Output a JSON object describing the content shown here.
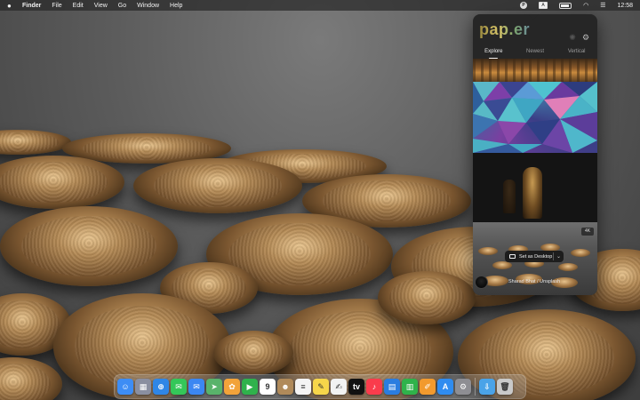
{
  "menubar": {
    "app_name": "Finder",
    "menus": [
      "File",
      "Edit",
      "View",
      "Go",
      "Window",
      "Help"
    ],
    "input_source": "A",
    "clock": "12:58"
  },
  "paper_app": {
    "logo": "pap.er",
    "tabs": [
      {
        "label": "Explore",
        "active": true
      },
      {
        "label": "Newest",
        "active": false
      },
      {
        "label": "Vertical",
        "active": false
      }
    ],
    "feed": {
      "badge": "4K",
      "set_desktop_label": "Set as Desktop",
      "credit": "Sharad Bhat / Unsplash"
    }
  },
  "dock": {
    "apps": [
      {
        "name": "finder-icon",
        "color": "#3d8df5",
        "glyph": "☺"
      },
      {
        "name": "launchpad-icon",
        "color": "#8a8fa0",
        "glyph": "▦"
      },
      {
        "name": "safari-icon",
        "color": "#2f86e6",
        "glyph": "⊕"
      },
      {
        "name": "messages-icon",
        "color": "#34c759",
        "glyph": "✉"
      },
      {
        "name": "mail-icon",
        "color": "#3b87f2",
        "glyph": "✉"
      },
      {
        "name": "maps-icon",
        "color": "#59b36b",
        "glyph": "➤"
      },
      {
        "name": "photos-icon",
        "color": "#f2a33a",
        "glyph": "✿"
      },
      {
        "name": "facetime-icon",
        "color": "#30b24c",
        "glyph": "▶"
      },
      {
        "name": "calendar-icon",
        "color": "#ffffff",
        "glyph": "9"
      },
      {
        "name": "contacts-icon",
        "color": "#b08a5a",
        "glyph": "☻"
      },
      {
        "name": "reminders-icon",
        "color": "#f4f4f4",
        "glyph": "≡"
      },
      {
        "name": "notes-icon",
        "color": "#f6d64a",
        "glyph": "✎"
      },
      {
        "name": "freeform-icon",
        "color": "#f2f2f2",
        "glyph": "✍"
      },
      {
        "name": "tv-icon",
        "color": "#111111",
        "glyph": "tv"
      },
      {
        "name": "music-icon",
        "color": "#fa3c4c",
        "glyph": "♪"
      },
      {
        "name": "keynote-icon",
        "color": "#2b7de0",
        "glyph": "▤"
      },
      {
        "name": "numbers-icon",
        "color": "#2fb34b",
        "glyph": "▥"
      },
      {
        "name": "pages-icon",
        "color": "#f29a2e",
        "glyph": "✐"
      },
      {
        "name": "app-store-icon",
        "color": "#2f8cf0",
        "glyph": "A"
      },
      {
        "name": "system-settings-icon",
        "color": "#8e8e93",
        "glyph": "⚙"
      },
      {
        "name": "downloads-folder-icon",
        "color": "#4aa3e8",
        "glyph": "⇩"
      },
      {
        "name": "trash-icon",
        "color": "#c9c9c9",
        "glyph": "🗑"
      }
    ]
  }
}
